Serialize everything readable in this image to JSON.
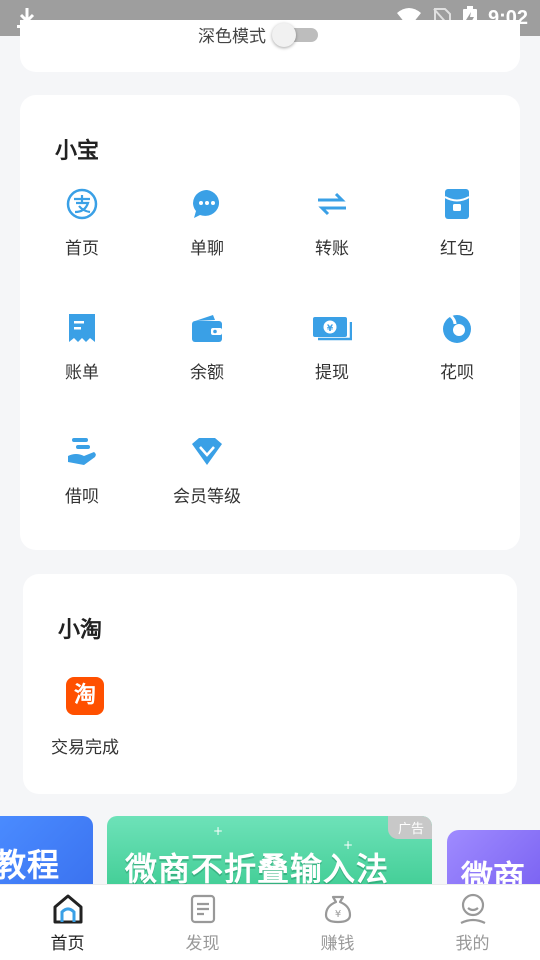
{
  "status_bar": {
    "time": "9:02",
    "left_icon": "download-icon",
    "right_icons": [
      "wifi-icon",
      "no-sim-icon",
      "battery-charging-icon"
    ]
  },
  "settings": {
    "dark_mode_label": "深色模式",
    "dark_mode_on": false
  },
  "xiaobao": {
    "title": "小宝",
    "items": [
      {
        "label": "首页",
        "icon": "alipay-icon"
      },
      {
        "label": "单聊",
        "icon": "chat-bubble-icon"
      },
      {
        "label": "转账",
        "icon": "transfer-arrows-icon"
      },
      {
        "label": "红包",
        "icon": "red-envelope-icon"
      },
      {
        "label": "账单",
        "icon": "bill-receipt-icon"
      },
      {
        "label": "余额",
        "icon": "wallet-icon"
      },
      {
        "label": "提现",
        "icon": "cash-withdraw-icon"
      },
      {
        "label": "花呗",
        "icon": "huabei-icon"
      },
      {
        "label": "借呗",
        "icon": "jiebei-hand-icon"
      },
      {
        "label": "会员等级",
        "icon": "diamond-icon"
      }
    ]
  },
  "xiaotao": {
    "title": "小淘",
    "items": [
      {
        "label": "交易完成",
        "icon": "taobao-icon",
        "icon_text": "淘"
      }
    ]
  },
  "banners": {
    "left_text": "教程",
    "center_text": "微商不折叠输入法",
    "center_badge": "广告",
    "right_text": "微商"
  },
  "bottom_nav": [
    {
      "label": "首页",
      "icon": "home-icon",
      "active": true
    },
    {
      "label": "发现",
      "icon": "discover-document-icon",
      "active": false
    },
    {
      "label": "赚钱",
      "icon": "money-bag-icon",
      "active": false
    },
    {
      "label": "我的",
      "icon": "profile-icon",
      "active": false
    }
  ],
  "colors": {
    "accent_blue": "#3aa0e6",
    "taobao_orange": "#ff5000",
    "banner_green": "#45cf98"
  }
}
